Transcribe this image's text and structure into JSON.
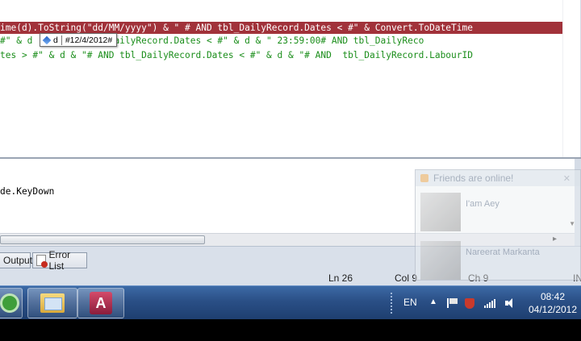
{
  "editor": {
    "line1": "ime(d).ToString(\"dd/MM/yyyy\") & \" # AND tbl_DailyRecord.Dates < #\" & Convert.ToDateTime",
    "line2": "#\" & d    # AND tbl_DailyRecord.Dates < #\" & d & \" 23:59:00# AND tbl_DailyReco",
    "line3": "tes > #\" & d & \"# AND tbl_DailyRecord.Dates < #\" & d & \"# AND  tbl_DailyRecord.LabourID",
    "datatip": {
      "name": "d",
      "value": "#12/4/2012#"
    }
  },
  "lower_pane": {
    "line": "de.KeyDown"
  },
  "tabs": {
    "output": "Output",
    "error_list": "Error List"
  },
  "status": {
    "ln": "Ln 26",
    "col": "Col 9",
    "ch": "Ch 9",
    "ins": "IN"
  },
  "notification": {
    "title": "Friends are online!",
    "friends": [
      {
        "name": "I'am Aey"
      },
      {
        "name": "Nareerat Markanta"
      }
    ]
  },
  "taskbar": {
    "language": "EN",
    "time": "08:42",
    "date": "04/12/2012",
    "apps": [
      "visual-studio",
      "windows-explorer",
      "microsoft-access"
    ]
  },
  "colors": {
    "highlight_line": "#a1323a",
    "string_green": "#1b8e1b",
    "taskbar": "#2a4f86"
  }
}
